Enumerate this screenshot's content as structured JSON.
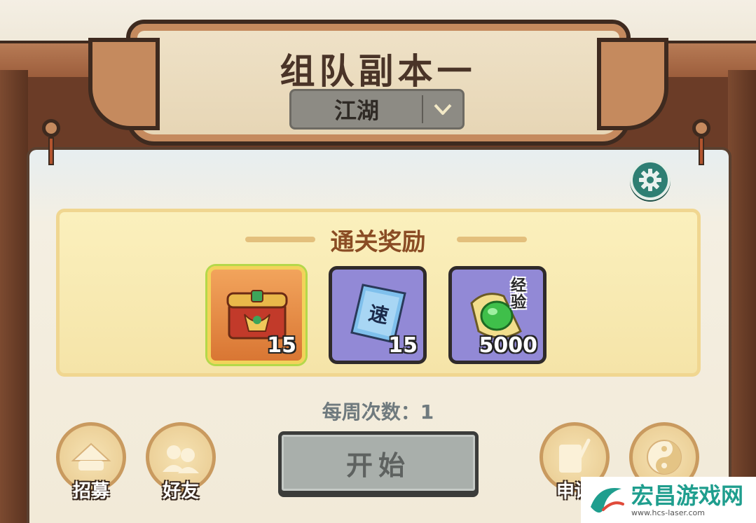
{
  "header": {
    "title": "组队副本一",
    "difficulty": {
      "selected": "江湖"
    }
  },
  "rewards": {
    "title": "通关奖励",
    "items": [
      {
        "icon": "treasure-chest-icon",
        "count": "15"
      },
      {
        "icon": "speed-ticket-icon",
        "ticket_text": "速",
        "count": "15"
      },
      {
        "icon": "experience-jade-icon",
        "tag": "经验",
        "count": "5000"
      }
    ]
  },
  "weekly": {
    "text": "每周次数：1"
  },
  "start_button": {
    "label": "开始"
  },
  "side_buttons": {
    "recruit": {
      "label": "招募",
      "icon": "straw-hat-icon"
    },
    "friends": {
      "label": "好友",
      "icon": "friends-icon"
    },
    "apply": {
      "label": "申请",
      "icon": "scroll-brush-icon"
    },
    "other": {
      "icon": "yin-yang-icon"
    }
  },
  "watermark": {
    "name": "宏昌游戏网",
    "url": "www.hcs-laser.com"
  },
  "colors": {
    "frame_wood": "#9a5b3a",
    "title_text": "#4a3428",
    "rewards_title": "#8a4c24",
    "settings_teal": "#2e7f73",
    "start_disabled": "#a9afab"
  }
}
